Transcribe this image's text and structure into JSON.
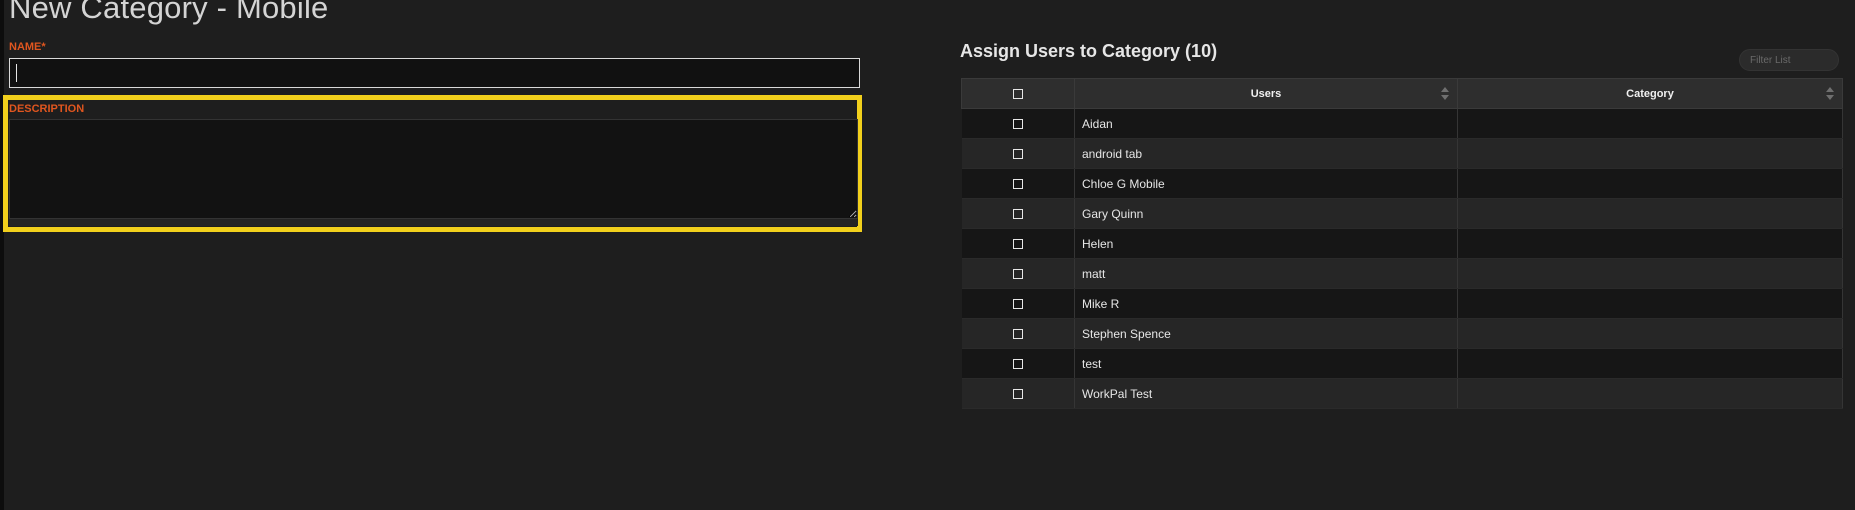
{
  "page": {
    "title": "New Category - Mobile"
  },
  "form": {
    "name_label": "NAME*",
    "name_value": "",
    "description_label": "DESCRIPTION",
    "description_value": ""
  },
  "assign": {
    "title": "Assign Users to Category (10)",
    "filter_placeholder": "Filter List",
    "columns": {
      "users": "Users",
      "category": "Category"
    },
    "rows": [
      {
        "user": "Aidan",
        "category": "",
        "checked": false
      },
      {
        "user": "android tab",
        "category": "",
        "checked": false
      },
      {
        "user": "Chloe G Mobile",
        "category": "",
        "checked": false
      },
      {
        "user": "Gary Quinn",
        "category": "",
        "checked": false
      },
      {
        "user": "Helen",
        "category": "",
        "checked": false
      },
      {
        "user": "matt",
        "category": "",
        "checked": false
      },
      {
        "user": "Mike R",
        "category": "",
        "checked": false
      },
      {
        "user": "Stephen Spence",
        "category": "",
        "checked": false
      },
      {
        "user": "test",
        "category": "",
        "checked": false
      },
      {
        "user": "WorkPal Test",
        "category": "",
        "checked": false
      }
    ]
  },
  "colors": {
    "background": "#1e1e1e",
    "label_accent": "#e0561f",
    "highlight": "#f2d01c"
  }
}
